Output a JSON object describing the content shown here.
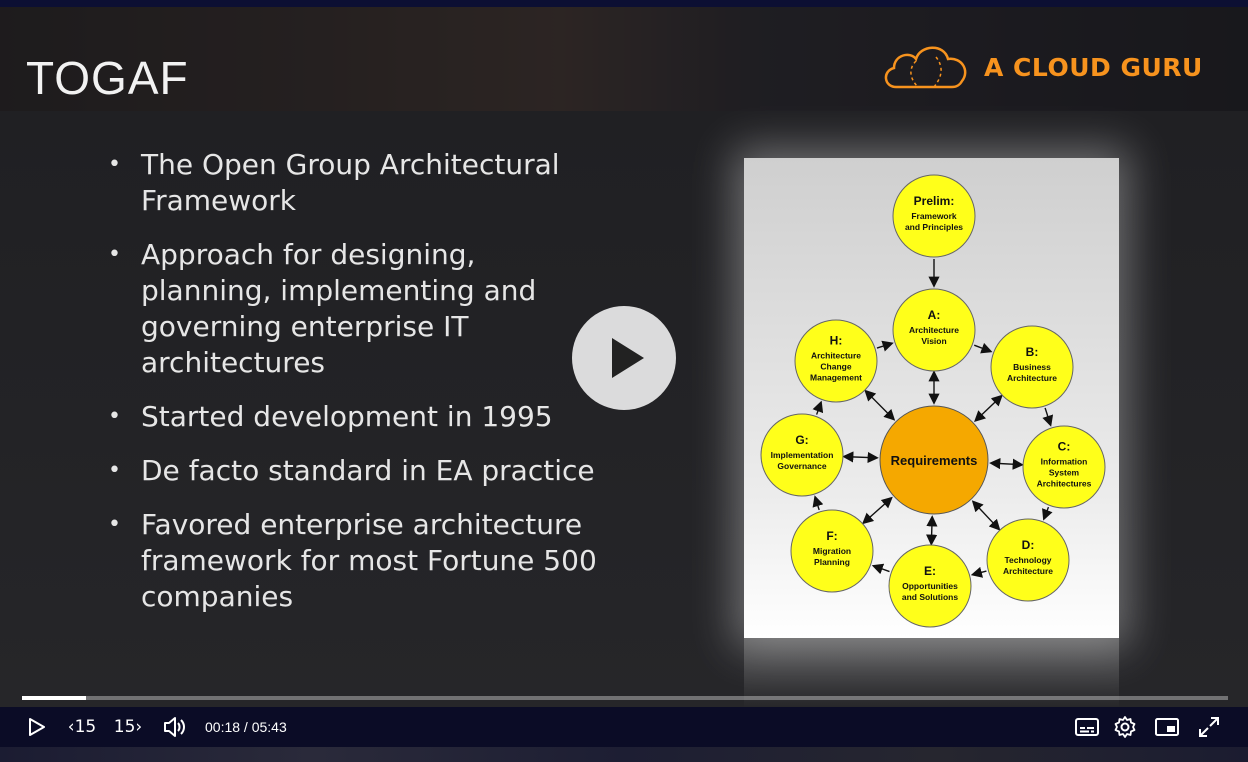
{
  "slide": {
    "title": "TOGAF",
    "logo_text": "A CLOUD GURU",
    "bullets": [
      "The Open Group Architectural Framework",
      "Approach for designing, planning, implementing and governing enterprise IT architectures",
      "Started development in 1995",
      "De facto standard in EA practice",
      "Favored enterprise architecture framework for most Fortune 500 companies"
    ],
    "diagram": {
      "center": "Requirements",
      "nodes": [
        {
          "letter": "Prelim",
          "suffix": ":",
          "lines": [
            "Framework",
            "and Principles"
          ]
        },
        {
          "letter": "A",
          "suffix": ":",
          "lines": [
            "Architecture",
            "Vision"
          ]
        },
        {
          "letter": "B",
          "suffix": ":",
          "lines": [
            "Business",
            "Architecture"
          ]
        },
        {
          "letter": "C",
          "suffix": ":",
          "lines": [
            "Information",
            "System",
            "Architectures"
          ]
        },
        {
          "letter": "D",
          "suffix": ":",
          "lines": [
            "Technology",
            "Architecture"
          ]
        },
        {
          "letter": "E",
          "suffix": ":",
          "lines": [
            "Opportunities",
            "and Solutions"
          ]
        },
        {
          "letter": "F",
          "suffix": ":",
          "lines": [
            "Migration",
            "Planning"
          ]
        },
        {
          "letter": "G",
          "suffix": ":",
          "lines": [
            "Implementation",
            "Governance"
          ]
        },
        {
          "letter": "H",
          "suffix": ":",
          "lines": [
            "Architecture",
            "Change",
            "Management"
          ]
        }
      ]
    }
  },
  "player": {
    "progress_fraction": 0.053,
    "skip_back_label": "15",
    "skip_forward_label": "15",
    "current_time": "00:18",
    "duration": "05:43",
    "time_separator": " / "
  },
  "colors": {
    "accent": "#f7931e",
    "node_fill": "#ffff1a",
    "center_fill": "#f5a800",
    "controls_bg": "#0b0c26"
  }
}
